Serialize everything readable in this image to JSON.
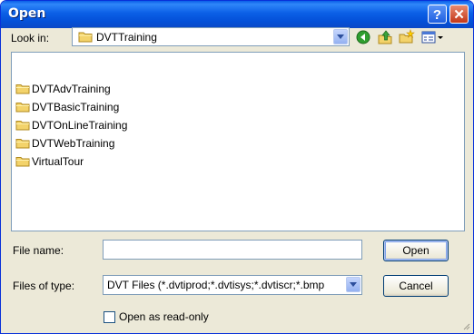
{
  "window": {
    "title": "Open"
  },
  "titlebar": {
    "help_label": "?",
    "close_label": "✕"
  },
  "look_in": {
    "label": "Look in:",
    "value": "DVTTraining"
  },
  "toolbar": {
    "icons": [
      "back-icon",
      "up-folder-icon",
      "new-folder-icon",
      "view-menu-icon"
    ]
  },
  "file_list": {
    "items": [
      "DVTAdvTraining",
      "DVTBasicTraining",
      "DVTOnLineTraining",
      "DVTWebTraining",
      "VirtualTour"
    ]
  },
  "file_name": {
    "label": "File name:",
    "value": ""
  },
  "files_of_type": {
    "label": "Files of type:",
    "value": "DVT Files (*.dvtiprod;*.dvtisys;*.dvtiscr;*.bmp"
  },
  "buttons": {
    "open": "Open",
    "cancel": "Cancel"
  },
  "read_only": {
    "label": "Open as read-only",
    "checked": false
  },
  "colors": {
    "title_bar": "#0a5ee8",
    "dialog_bg": "#ece9d8",
    "folder": "#f3d36b",
    "field_border": "#7f9db9"
  }
}
